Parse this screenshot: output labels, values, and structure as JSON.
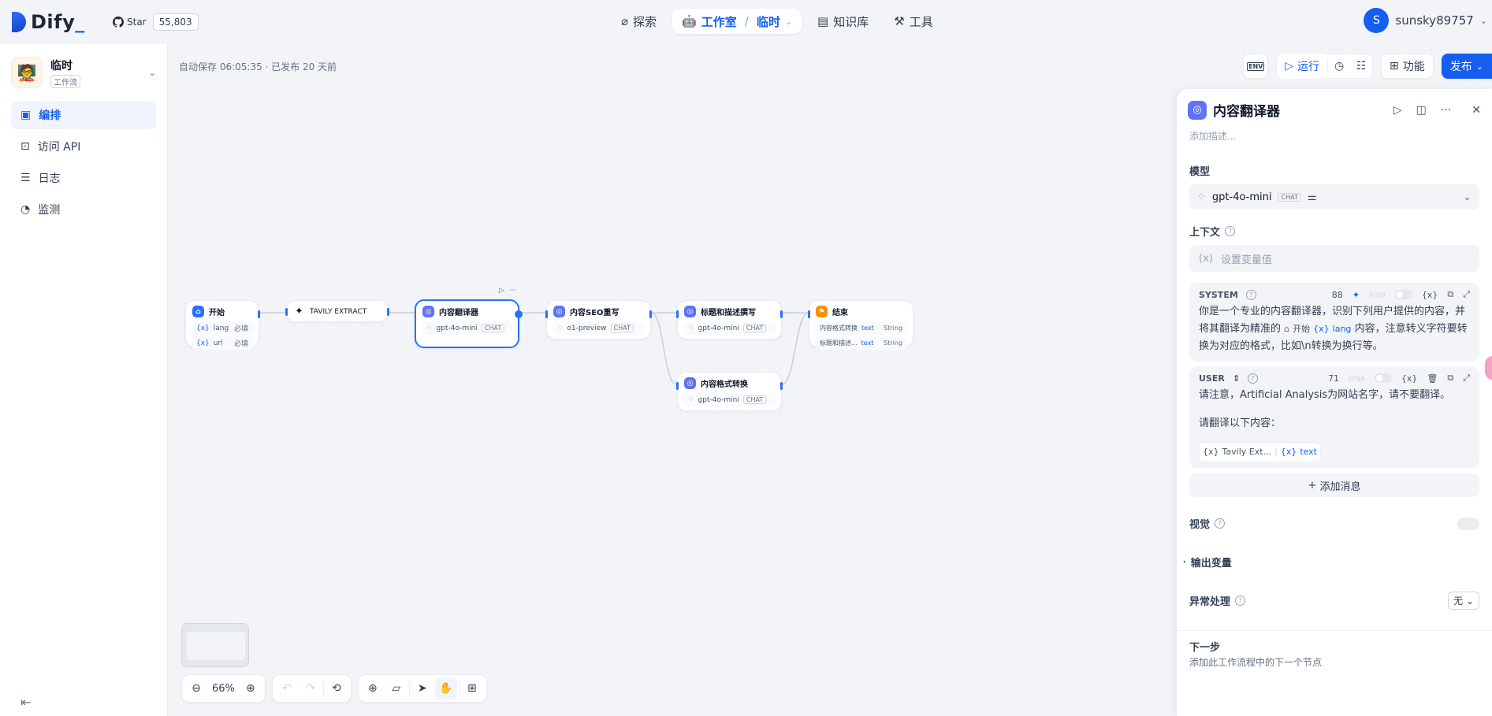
{
  "brand": {
    "name": "Dify",
    "underscore": "_"
  },
  "github": {
    "label": "Star",
    "count": "55,803"
  },
  "nav": {
    "explore": "探索",
    "studio": "工作室",
    "studio_app": "临时",
    "knowledge": "知识库",
    "tools": "工具"
  },
  "user": {
    "initial": "S",
    "name": "sunsky89757"
  },
  "sidebar": {
    "app_name": "临时",
    "app_type": "工作流",
    "items": [
      {
        "label": "编排"
      },
      {
        "label": "访问 API"
      },
      {
        "label": "日志"
      },
      {
        "label": "监测"
      }
    ]
  },
  "canvas": {
    "autosave": "自动保存 06:05:35 · 已发布 20 天前",
    "actions": {
      "env": "ENV",
      "run": "运行",
      "features": "功能",
      "publish": "发布"
    },
    "zoom": "66%"
  },
  "nodes": [
    {
      "title": "开始",
      "rows": [
        {
          "left": "lang",
          "right": "必填"
        },
        {
          "left": "url",
          "right": "必填"
        }
      ]
    },
    {
      "title": "TAVILY EXTRACT"
    },
    {
      "title": "内容翻译器",
      "model": "gpt-4o-mini",
      "chip": "CHAT"
    },
    {
      "title": "内容SEO重写",
      "model": "o1-preview",
      "chip": "CHAT"
    },
    {
      "title": "标题和描述撰写",
      "model": "gpt-4o-mini",
      "chip": "CHAT"
    },
    {
      "title": "内容格式转换",
      "model": "gpt-4o-mini",
      "chip": "CHAT"
    },
    {
      "title": "结束",
      "rows": [
        {
          "left": "内容格式转换",
          "var": "text",
          "right": "String"
        },
        {
          "left": "标题和描述...",
          "var": "text",
          "right": "String"
        }
      ]
    }
  ],
  "panel": {
    "title": "内容翻译器",
    "desc_placeholder": "添加描述...",
    "model_label": "模型",
    "model_name": "gpt-4o-mini",
    "model_chip": "CHAT",
    "context_label": "上下文",
    "context_placeholder": "设置变量值",
    "system": {
      "role": "SYSTEM",
      "count": "88",
      "jinja": "jinja",
      "text_before": "你是一个专业的内容翻译器，识别下列用户提供的内容，并将其翻译为精准的",
      "var_node": "开始",
      "var_name": "lang",
      "text_after": "内容，注意转义字符要转换为对应的格式，比如\\n转换为换行等。"
    },
    "user": {
      "role": "USER",
      "count": "71",
      "jinja": "jinja",
      "line1": "请注意，Artificial Analysis为网站名字，请不要翻译。",
      "line2": "请翻译以下内容：",
      "var_node": "Tavily Ext...",
      "var_name": "text"
    },
    "add_message": "添加消息",
    "vision_label": "视觉",
    "output_label": "输出变量",
    "error_label": "异常处理",
    "error_value": "无",
    "next_label": "下一步",
    "next_desc": "添加此工作流程中的下一个节点"
  }
}
